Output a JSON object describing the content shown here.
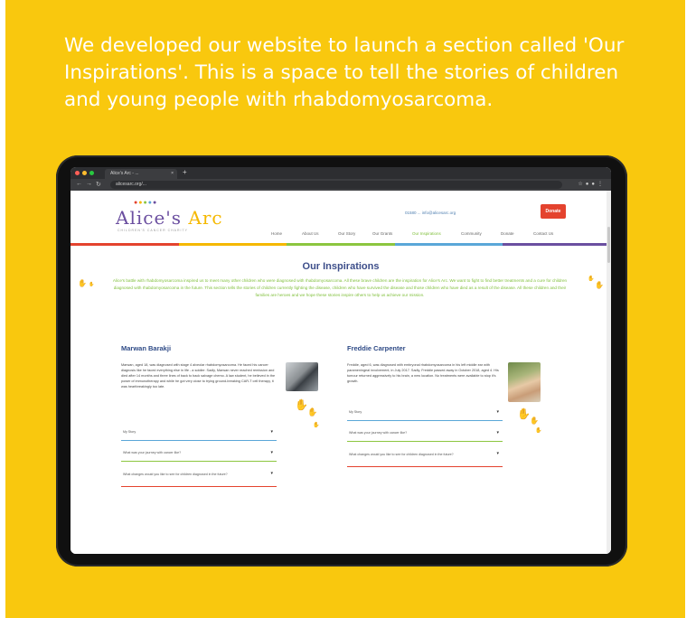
{
  "intro_text": "We developed our website to launch a section called 'Our Inspirations'. This is a space to tell the stories of children and young people with rhabdomyosarcoma.",
  "colors": {
    "background": "#f9c80e",
    "intro_text": "#ffffff",
    "brand_purple": "#6b4fa0",
    "brand_blue": "#2e4a86",
    "body_green": "#7fbf3a",
    "donate_red": "#e4432e",
    "rule_blue": "#5aa7d8",
    "rule_green": "#8cc63f",
    "rule_red": "#e4432e"
  },
  "browser": {
    "tab_title": "Alice's Arc - ...",
    "url": "alicesarc.org/..."
  },
  "site": {
    "logo_main": "Alice's",
    "logo_arc": "Arc",
    "logo_sub": "CHILDREN'S CANCER CHARITY",
    "topbar_contact": "01580 ...   info@alicesarc.org",
    "donate_label": "Donate",
    "menu": [
      "Home",
      "About Us",
      "Our Story",
      "Our Grants",
      "Our Inspirations",
      "Community",
      "Donate",
      "Contact Us"
    ],
    "page_title": "Our Inspirations",
    "page_intro": "Alice's battle with rhabdomyosarcoma inspired us to meet many other children who were diagnosed with rhabdomyosarcoma. All these brave children are the inspiration for Alice's Arc. We want to fight to find better treatments and a cure for children diagnosed with rhabdomyosarcoma in the future. This section tells the stories of children currently fighting the disease, children who have survived the disease and those children who have died as a result of the disease. All these children and their families are heroes and we hope these stories inspire others to help us achieve our mission.",
    "cards": [
      {
        "name": "Marwan Barakji",
        "text": "Marwan, aged 18, was diagnosed with stage 4 alveolar rhabdomyosarcoma. He faced his cancer diagnosis like he faced everything else in life - a soldier. Sadly, Marwan never reached remission and died after 14 months and three lines of back to back salvage chemo. A law student, he believed in the power of immunotherapy and while he got very close to trying ground-breaking CAR-T cell therapy, it was heartbreakingly too late.",
        "accordions": [
          "My Story",
          "What was your journey with cancer like?",
          "What changes would you like to see for children diagnosed in the future?"
        ]
      },
      {
        "name": "Freddie Carpenter",
        "text": "Freddie, aged 6, was diagnosed with embryonal rhabdomyosarcoma in his left middle ear with parameningeal involvement, in July 2017. Sadly, Freddie passed away in October 2018, aged 4. His tumour returned aggressively to his brain, a new location. No treatments were available to stop it's growth.",
        "accordions": [
          "My Story",
          "What was your journey with cancer like?",
          "What changes would you like to see for children diagnosed in the future?"
        ]
      }
    ]
  }
}
